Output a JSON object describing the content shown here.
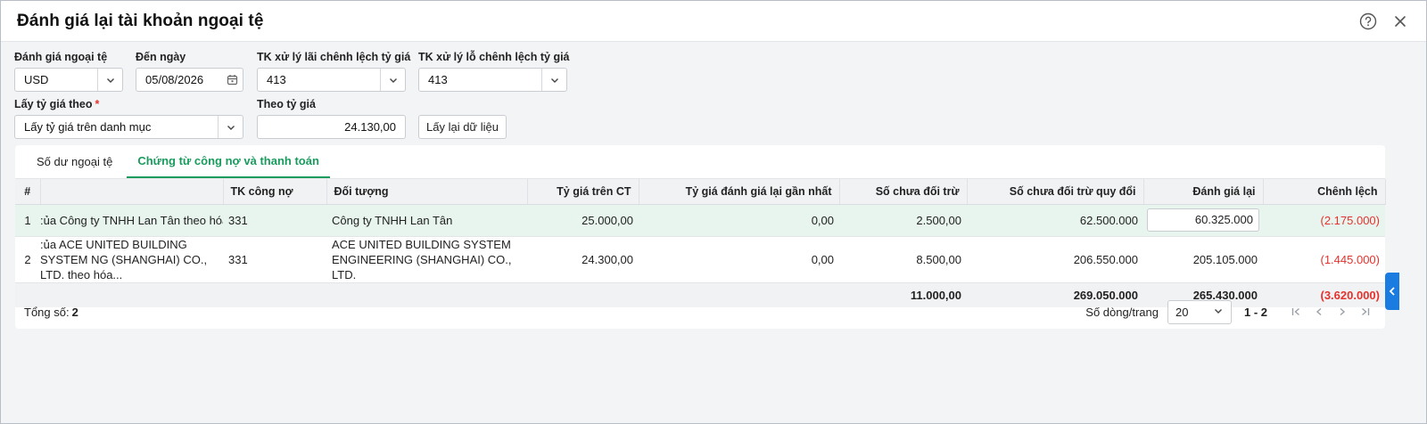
{
  "dialog": {
    "title": "Đánh giá lại tài khoản ngoại tệ"
  },
  "form": {
    "currency": {
      "label": "Đánh giá ngoại tệ",
      "value": "USD"
    },
    "to_date": {
      "label": "Đến ngày",
      "value": "05/08/2026"
    },
    "gain_account": {
      "label": "TK xử lý lãi chênh lệch tỷ giá",
      "value": "413"
    },
    "loss_account": {
      "label": "TK xử lý lỗ chênh lệch tỷ giá",
      "value": "413"
    },
    "rate_source": {
      "label": "Lấy tỷ giá theo",
      "required_mark": "*",
      "value": "Lấy tỷ giá trên danh mục"
    },
    "rate": {
      "label": "Theo tỷ giá",
      "value": "24.130,00"
    },
    "reload_button": "Lấy lại dữ liệu"
  },
  "tabs": [
    {
      "label": "Số dư ngoại tệ",
      "active": false
    },
    {
      "label": "Chứng từ công nợ và thanh toán",
      "active": true
    }
  ],
  "table": {
    "columns": [
      "#",
      "",
      "TK công nợ",
      "Đối tượng",
      "Tỷ giá trên CT",
      "Tỷ giá đánh giá lại gần nhất",
      "Số chưa đối trừ",
      "Số chưa đối trừ quy đổi",
      "Đánh giá lại",
      "Chênh lệch"
    ],
    "rows": [
      {
        "index": "1",
        "description": ":ủa Công ty TNHH Lan Tân theo hóa",
        "account": "331",
        "partner": "Công ty TNHH Lan Tân",
        "doc_rate": "25.000,00",
        "last_rate": "0,00",
        "unoffset": "2.500,00",
        "unoffset_converted": "62.500.000",
        "revalued": "60.325.000",
        "difference": "(2.175.000)"
      },
      {
        "index": "2",
        "description": ":ủa ACE UNITED BUILDING SYSTEM NG (SHANGHAI) CO., LTD. theo hóa...",
        "account": "331",
        "partner": "ACE UNITED BUILDING SYSTEM ENGINEERING (SHANGHAI) CO., LTD.",
        "doc_rate": "24.300,00",
        "last_rate": "0,00",
        "unoffset": "8.500,00",
        "unoffset_converted": "206.550.000",
        "revalued": "205.105.000",
        "difference": "(1.445.000)"
      }
    ],
    "summary": {
      "unoffset": "11.000,00",
      "unoffset_converted": "269.050.000",
      "revalued": "265.430.000",
      "difference": "(3.620.000)"
    }
  },
  "footer": {
    "total_label": "Tổng số:",
    "total_value": "2",
    "rows_per_page_label": "Số dòng/trang",
    "rows_per_page": "20",
    "range": "1 - 2"
  },
  "colors": {
    "accent": "#1a9b5e",
    "negative": "#e5322d",
    "side_tab": "#1a7be0"
  }
}
